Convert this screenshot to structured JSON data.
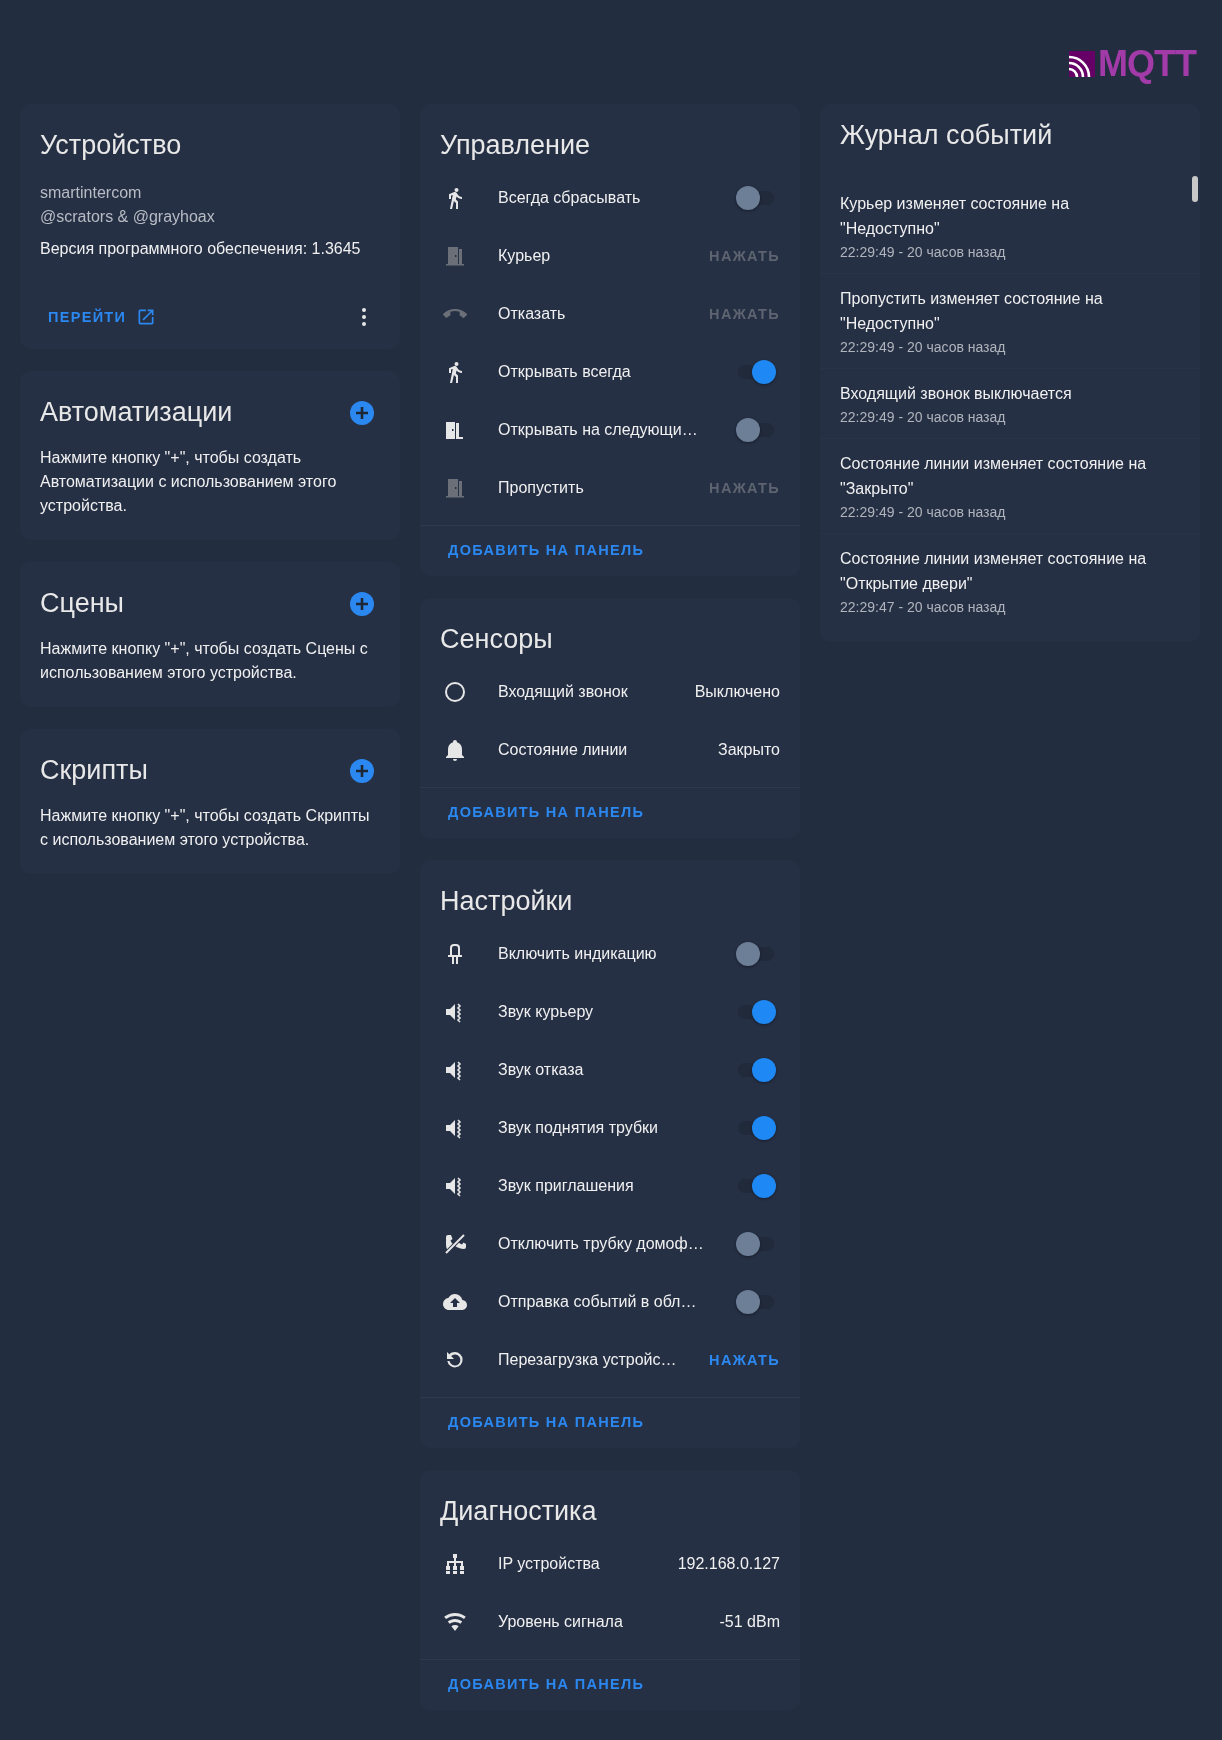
{
  "header": {
    "logo_text": "MQTT"
  },
  "device": {
    "title": "Устройство",
    "model": "smartintercom",
    "manufacturer": "@scrators & @grayhoax",
    "firmware": "Версия программного обеспечения: 1.3645",
    "link": "ПЕРЕЙТИ"
  },
  "info_cards": [
    {
      "title": "Автоматизации",
      "text": "Нажмите кнопку \"+\", чтобы создать Автоматизации с использованием этого устройства."
    },
    {
      "title": "Сцены",
      "text": "Нажмите кнопку \"+\", чтобы создать Сцены с использованием этого устройства."
    },
    {
      "title": "Скрипты",
      "text": "Нажмите кнопку \"+\", чтобы создать Скрипты с использованием этого устройства."
    }
  ],
  "entity_cards": [
    {
      "title": "Управление",
      "footer": "ДОБАВИТЬ НА ПАНЕЛЬ",
      "rows": [
        {
          "kind": "toggle",
          "label": "Всегда сбрасывать",
          "on": false,
          "disabled": false
        },
        {
          "kind": "button",
          "label": "Курьер",
          "action": "НАЖАТЬ",
          "disabled": true
        },
        {
          "kind": "button",
          "label": "Отказать",
          "action": "НАЖАТЬ",
          "disabled": true
        },
        {
          "kind": "toggle",
          "label": "Открывать всегда",
          "on": true,
          "disabled": false
        },
        {
          "kind": "toggle",
          "label": "Открывать на следующи…",
          "on": false,
          "disabled": false
        },
        {
          "kind": "button",
          "label": "Пропустить",
          "action": "НАЖАТЬ",
          "disabled": true
        }
      ]
    },
    {
      "title": "Сенсоры",
      "footer": "ДОБАВИТЬ НА ПАНЕЛЬ",
      "rows": [
        {
          "kind": "value",
          "label": "Входящий звонок",
          "value": "Выключено"
        },
        {
          "kind": "value",
          "label": "Состояние линии",
          "value": "Закрыто"
        }
      ]
    },
    {
      "title": "Настройки",
      "footer": "ДОБАВИТЬ НА ПАНЕЛЬ",
      "rows": [
        {
          "kind": "toggle",
          "label": "Включить индикацию",
          "on": false,
          "disabled": false
        },
        {
          "kind": "toggle",
          "label": "Звук курьеру",
          "on": true,
          "disabled": false
        },
        {
          "kind": "toggle",
          "label": "Звук отказа",
          "on": true,
          "disabled": false
        },
        {
          "kind": "toggle",
          "label": "Звук поднятия трубки",
          "on": true,
          "disabled": false
        },
        {
          "kind": "toggle",
          "label": "Звук приглашения",
          "on": true,
          "disabled": false
        },
        {
          "kind": "toggle",
          "label": "Отключить трубку домоф…",
          "on": false,
          "disabled": false
        },
        {
          "kind": "toggle",
          "label": "Отправка событий в обл…",
          "on": false,
          "disabled": false
        },
        {
          "kind": "button",
          "label": "Перезагрузка устройс…",
          "action": "НАЖАТЬ",
          "disabled": false
        }
      ]
    },
    {
      "title": "Диагностика",
      "footer": "ДОБАВИТЬ НА ПАНЕЛЬ",
      "rows": [
        {
          "kind": "value",
          "label": "IP устройства",
          "value": "192.168.0.127"
        },
        {
          "kind": "value",
          "label": "Уровень сигнала",
          "value": "-51 dBm"
        }
      ]
    }
  ],
  "log": {
    "title": "Журнал событий",
    "entries": [
      {
        "message": "Курьер изменяет состояние на \"Недоступно\"",
        "time": "22:29:49 - 20 часов назад"
      },
      {
        "message": "Пропустить изменяет состояние на \"Недоступно\"",
        "time": "22:29:49 - 20 часов назад"
      },
      {
        "message": "Входящий звонок выключается",
        "time": "22:29:49 - 20 часов назад"
      },
      {
        "message": "Состояние линии изменяет состояние на \"Закрыто\"",
        "time": "22:29:49 - 20 часов назад"
      },
      {
        "message": "Состояние линии изменяет состояние на \"Открытие двери\"",
        "time": "22:29:47 - 20 часов назад"
      }
    ]
  }
}
